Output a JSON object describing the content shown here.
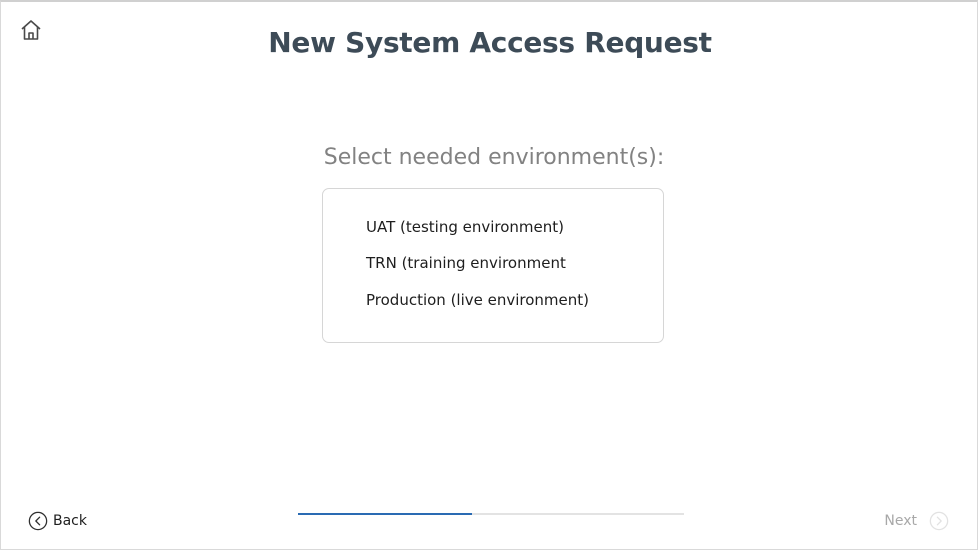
{
  "header": {
    "home_icon": "home-icon",
    "title": "New System Access Request"
  },
  "question": {
    "prompt": "Select needed environment(s):",
    "options": [
      "UAT (testing environment)",
      "TRN (training environment",
      "Production (live environment)"
    ]
  },
  "footer": {
    "back_label": "Back",
    "back_icon": "chevron-left-circle-icon",
    "next_label": "Next",
    "next_icon": "chevron-right-circle-icon",
    "next_enabled": false,
    "progress_fraction": 0.45
  },
  "colors": {
    "title": "#3d4b57",
    "prompt": "#828282",
    "progress_fill": "#2a6bb3",
    "progress_track": "#e3e3e3",
    "disabled_text": "#a8a8a8"
  }
}
